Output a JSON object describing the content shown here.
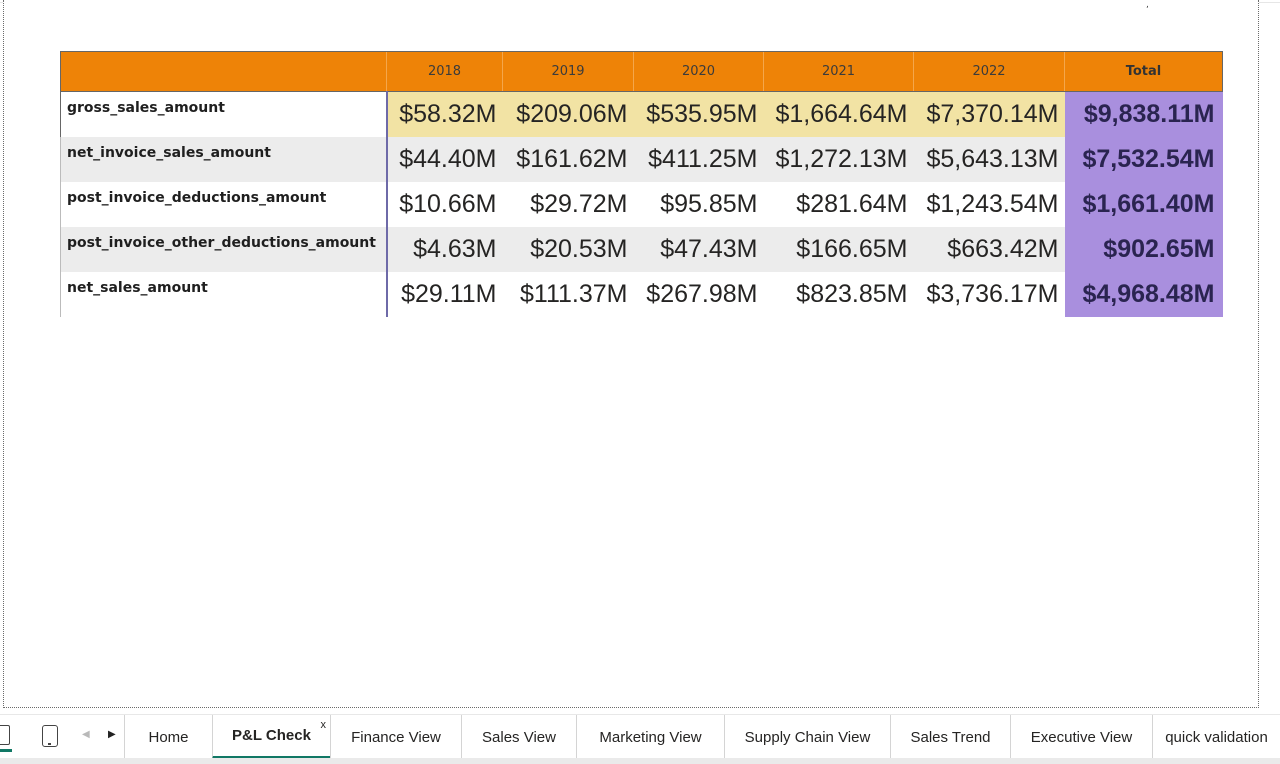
{
  "matrix": {
    "row_header_label": "",
    "columns": [
      "2018",
      "2019",
      "2020",
      "2021",
      "2022",
      "Total"
    ],
    "rows": [
      {
        "label": "gross_sales_amount",
        "values": [
          "$58.32M",
          "$209.06M",
          "$535.95M",
          "$1,664.64M",
          "$7,370.14M"
        ],
        "total": "$9,838.11M"
      },
      {
        "label": "net_invoice_sales_amount",
        "values": [
          "$44.40M",
          "$161.62M",
          "$411.25M",
          "$1,272.13M",
          "$5,643.13M"
        ],
        "total": "$7,532.54M"
      },
      {
        "label": "post_invoice_deductions_amount",
        "values": [
          "$10.66M",
          "$29.72M",
          "$95.85M",
          "$281.64M",
          "$1,243.54M"
        ],
        "total": "$1,661.40M"
      },
      {
        "label": "post_invoice_other_deductions_amount",
        "values": [
          "$4.63M",
          "$20.53M",
          "$47.43M",
          "$166.65M",
          "$663.42M"
        ],
        "total": "$902.65M"
      },
      {
        "label": "net_sales_amount",
        "values": [
          "$29.11M",
          "$111.37M",
          "$267.98M",
          "$823.85M",
          "$3,736.17M"
        ],
        "total": "$4,968.48M"
      }
    ],
    "colors": {
      "header": "#ee8307",
      "highlight_row": "#f2e3a4",
      "total_column": "#a98fde",
      "banded_row": "#ececec"
    }
  },
  "tabbar": {
    "view_icons": [
      "desktop-view-icon",
      "mobile-view-icon"
    ],
    "prev_arrow": "◀",
    "next_arrow": "▶",
    "close_glyph": "x",
    "tabs": [
      {
        "label": "Home"
      },
      {
        "label": "P&L Check",
        "active": true
      },
      {
        "label": "Finance View"
      },
      {
        "label": "Sales View"
      },
      {
        "label": "Marketing View"
      },
      {
        "label": "Supply Chain View"
      },
      {
        "label": "Sales Trend"
      },
      {
        "label": "Executive View"
      },
      {
        "label": "quick validation"
      }
    ],
    "accent": "#117865"
  }
}
